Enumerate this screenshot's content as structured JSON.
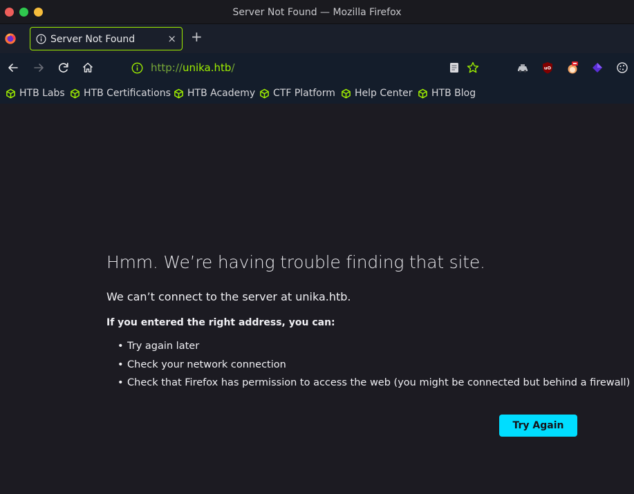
{
  "window": {
    "title": "Server Not Found — Mozilla Firefox"
  },
  "tab": {
    "label": "Server Not Found",
    "close_glyph": "×",
    "new_tab_glyph": "+"
  },
  "url_bar": {
    "prefix": "http://",
    "host": "unika.htb",
    "suffix": "/"
  },
  "bookmarks": [
    {
      "label": "HTB Labs"
    },
    {
      "label": "HTB Certifications"
    },
    {
      "label": "HTB Academy"
    },
    {
      "label": "CTF Platform"
    },
    {
      "label": "Help Center"
    },
    {
      "label": "HTB Blog"
    }
  ],
  "error_page": {
    "title": "Hmm. We’re having trouble finding that site.",
    "description": "We can’t connect to the server at unika.htb.",
    "suggestion_heading": "If you entered the right address, you can:",
    "suggestions": [
      "Try again later",
      "Check your network connection",
      "Check that Firefox has permission to access the web (you might be connected but behind a firewall)"
    ],
    "try_again_label": "Try Again"
  },
  "colors": {
    "accent_green": "#9fef00",
    "button_cyan": "#00ddff",
    "content_bg": "#1c1b22",
    "toolbar_bg": "#141d2b"
  }
}
